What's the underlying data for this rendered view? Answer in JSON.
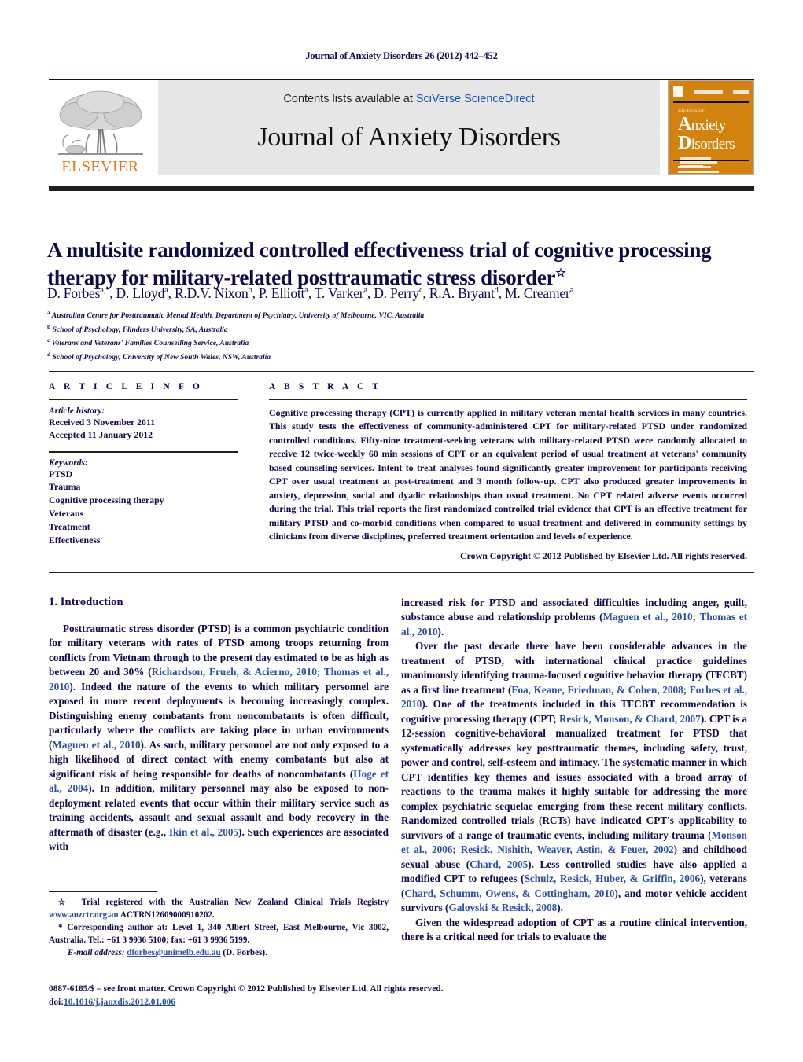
{
  "running_head": "Journal of Anxiety Disorders 26 (2012) 442–452",
  "masthead": {
    "publisher_name": "ELSEVIER",
    "contents_prefix": "Contents lists available at ",
    "contents_link": "SciVerse ScienceDirect",
    "journal_name": "Journal of Anxiety Disorders",
    "cover": {
      "supertitle": "JOURNAL OF",
      "line1": "Anxiety",
      "line2": "Disorders",
      "accent_color": "#D4820F"
    }
  },
  "article": {
    "title": "A multisite randomized controlled effectiveness trial of cognitive processing therapy for military-related posttraumatic stress disorder",
    "title_marker": "☆",
    "authors": "D. Forbes<sup>a,</sup><sup>*</sup>, D. Lloyd<sup>a</sup>, R.D.V. Nixon<sup>b</sup>, P. Elliott<sup>a</sup>, T. Varker<sup>a</sup>, D. Perry<sup>c</sup>, R.A. Bryant<sup>d</sup>, M. Creamer<sup>a</sup>",
    "affiliations": [
      "<sup>a</sup> Australian Centre for Posttraumatic Mental Health, Department of Psychiatry, University of Melbourne, VIC, Australia",
      "<sup>b</sup> School of Psychology, Flinders University, SA, Australia",
      "<sup>c</sup> Veterans and Veterans' Families Counselling Service, Australia",
      "<sup>d</sup> School of Psychology, University of New South Wales, NSW, Australia"
    ]
  },
  "article_info": {
    "heading": "A R T I C L E   I N F O",
    "history_label": "Article history:",
    "history": [
      "Received 3 November 2011",
      "Accepted 11 January 2012"
    ],
    "keywords_label": "Keywords:",
    "keywords": [
      "PTSD",
      "Trauma",
      "Cognitive processing therapy",
      "Veterans",
      "Treatment",
      "Effectiveness"
    ]
  },
  "abstract": {
    "heading": "A B S T R A C T",
    "text": "Cognitive processing therapy (CPT) is currently applied in military veteran mental health services in many countries. This study tests the effectiveness of community-administered CPT for military-related PTSD under randomized controlled conditions. Fifty-nine treatment-seeking veterans with military-related PTSD were randomly allocated to receive 12 twice-weekly 60 min sessions of CPT or an equivalent period of usual treatment at veterans' community based counseling services. Intent to treat analyses found significantly greater improvement for participants receiving CPT over usual treatment at post-treatment and 3 month follow-up. CPT also produced greater improvements in anxiety, depression, social and dyadic relationships than usual treatment. No CPT related adverse events occurred during the trial. This trial reports the first randomized controlled trial evidence that CPT is an effective treatment for military PTSD and co-morbid conditions when compared to usual treatment and delivered in community settings by clinicians from diverse disciplines, preferred treatment orientation and levels of experience.",
    "copyright": "Crown Copyright © 2012 Published by Elsevier Ltd. All rights reserved."
  },
  "body": {
    "section_heading": "1. Introduction",
    "left_paragraphs": [
      "Posttraumatic stress disorder (PTSD) is a common psychiatric condition for military veterans with rates of PTSD among troops returning from conflicts from Vietnam through to the present day estimated to be as high as between 20 and 30% (<span class=\"ref\">Richardson, Frueh, &amp; Acierno, 2010; Thomas et al., 2010</span>). Indeed the nature of the events to which military personnel are exposed in more recent deployments is becoming increasingly complex. Distinguishing enemy combatants from noncombatants is often difficult, particularly where the conflicts are taking place in urban environments (<span class=\"ref\">Maguen et al., 2010</span>). As such, military personnel are not only exposed to a high likelihood of direct contact with enemy combatants but also at significant risk of being responsible for deaths of noncombatants (<span class=\"ref\">Hoge et al., 2004</span>). In addition, military personnel may also be exposed to non-deployment related events that occur within their military service such as training accidents, assault and sexual assault and body recovery in the aftermath of disaster (e.g., <span class=\"ref\">Ikin et al., 2005</span>). Such experiences are associated with"
    ],
    "right_paragraphs": [
      "increased risk for PTSD and associated difficulties including anger, guilt, substance abuse and relationship problems (<span class=\"ref\">Maguen et al., 2010; Thomas et al., 2010</span>).",
      "Over the past decade there have been considerable advances in the treatment of PTSD, with international clinical practice guidelines unanimously identifying trauma-focused cognitive behavior therapy (TFCBT) as a first line treatment (<span class=\"ref\">Foa, Keane, Friedman, &amp; Cohen, 2008; Forbes et al., 2010</span>). One of the treatments included in this TFCBT recommendation is cognitive processing therapy (CPT; <span class=\"ref\">Resick, Monson, &amp; Chard, 2007</span>). CPT is a 12-session cognitive-behavioral manualized treatment for PTSD that systematically addresses key posttraumatic themes, including safety, trust, power and control, self-esteem and intimacy. The systematic manner in which CPT identifies key themes and issues associated with a broad array of reactions to the trauma makes it highly suitable for addressing the more complex psychiatric sequelae emerging from these recent military conflicts. Randomized controlled trials (RCTs) have indicated CPT's applicability to survivors of a range of traumatic events, including military trauma (<span class=\"ref\">Monson et al., 2006; Resick, Nishith, Weaver, Astin, &amp; Feuer, 2002</span>) and childhood sexual abuse (<span class=\"ref\">Chard, 2005</span>). Less controlled studies have also applied a modified CPT to refugees (<span class=\"ref\">Schulz, Resick, Huber, &amp; Griffin, 2006</span>), veterans (<span class=\"ref\">Chard, Schumm, Owens, &amp; Cottingham, 2010</span>), and motor vehicle accident survivors (<span class=\"ref\">Galovski &amp; Resick, 2008</span>).",
      "Given the widespread adoption of CPT as a routine clinical intervention, there is a critical need for trials to evaluate the"
    ]
  },
  "footnotes": {
    "trial_note": "<span style=\"font-size:10px\">☆</span>&nbsp; Trial registered with the Australian New Zealand Clinical Trials Registry <span class=\"lnk\">www.anzctr.org.au</span> ACTRN12609000910202.",
    "corresponding": "* Corresponding author at: Level 1, 340 Albert Street, East Melbourne, Vic 3002, Australia. Tel.: +61 3 9936 5100; fax: +61 3 9936 5199.",
    "email_label": "E-mail address:",
    "email": "dforbes@unimelb.edu.au",
    "email_owner": "(D. Forbes)."
  },
  "colophon": {
    "issn_line": "0887-6185/$ – see front matter. Crown Copyright © 2012 Published by Elsevier Ltd. All rights reserved.",
    "doi_label": "doi:",
    "doi": "10.1016/j.janxdis.2012.01.006"
  }
}
